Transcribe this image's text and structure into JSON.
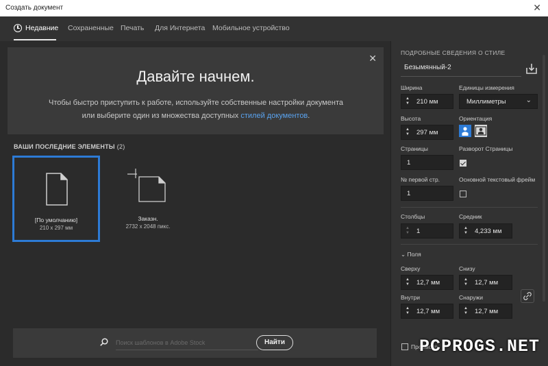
{
  "window": {
    "title": "Создать документ",
    "close_glyph": "✕"
  },
  "tabs": [
    {
      "label": "Недавние",
      "icon": "clock-icon",
      "active": true
    },
    {
      "label": "Сохраненные"
    },
    {
      "label": "Печать"
    },
    {
      "label": "Для Интернета"
    },
    {
      "label": "Мобильное устройство"
    }
  ],
  "welcome": {
    "heading": "Давайте начнем.",
    "desc_part1": "Чтобы быстро приступить к работе, используйте собственные настройки документа или выберите один из множества доступных ",
    "desc_link": "стилей документов",
    "desc_part2": ".",
    "close_glyph": "✕"
  },
  "recent": {
    "title": "ВАШИ ПОСЛЕДНИЕ ЭЛЕМЕНТЫ",
    "count": "(2)",
    "items": [
      {
        "name": "[По умолчанию]",
        "size": "210 x 297 мм",
        "selected": true
      },
      {
        "name": "Заказн.",
        "size": "2732 x 2048 пикс."
      }
    ]
  },
  "search": {
    "placeholder": "Поиск шаблонов в Adobe Stock",
    "button": "Найти"
  },
  "details": {
    "title": "ПОДРОБНЫЕ СВЕДЕНИЯ О СТИЛЕ",
    "doc_name": "Безымянный-2",
    "width_label": "Ширина",
    "width_value": "210 мм",
    "units_label": "Единицы измерения",
    "units_value": "Миллиметры",
    "height_label": "Высота",
    "height_value": "297 мм",
    "orientation_label": "Ориентация",
    "pages_label": "Страницы",
    "pages_value": "1",
    "facing_label": "Разворот Страницы",
    "facing_checked": true,
    "start_label": "№ первой стр.",
    "start_value": "1",
    "primary_frame_label": "Основной текстовый фрейм",
    "primary_frame_checked": false,
    "columns_label": "Столбцы",
    "columns_value": "1",
    "gutter_label": "Средник",
    "gutter_value": "4,233 мм",
    "margins_label": "Поля",
    "top_label": "Сверху",
    "top_value": "12,7 мм",
    "bottom_label": "Снизу",
    "bottom_value": "12,7 мм",
    "inside_label": "Внутри",
    "inside_value": "12,7 мм",
    "outside_label": "Снаружи",
    "outside_value": "12,7 мм",
    "preview_label": "Просмотр"
  },
  "watermark": "PCPROGS.NET",
  "colors": {
    "accent": "#2d7bd6",
    "link": "#5aa3ef",
    "panel": "#3a3a3a",
    "bg": "#2b2b2b"
  }
}
